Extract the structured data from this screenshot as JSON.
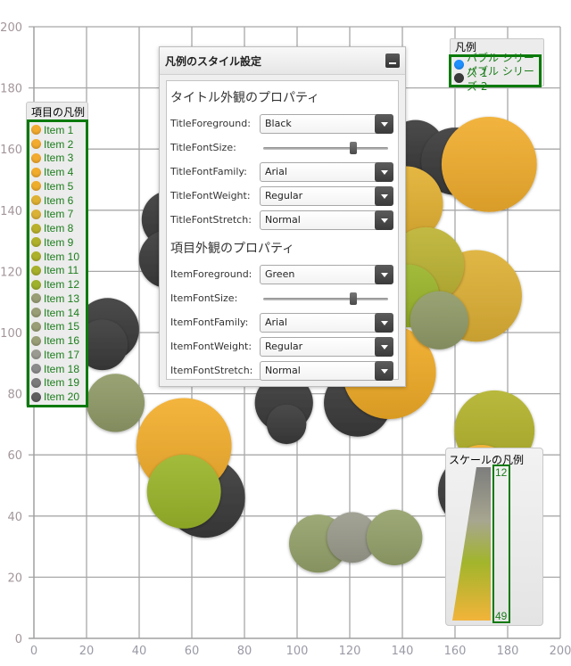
{
  "chart_data": {
    "type": "bubble",
    "title": "",
    "xlabel": "",
    "ylabel": "",
    "xlim": [
      0,
      200
    ],
    "ylim": [
      0,
      200
    ],
    "x_ticks": [
      0,
      20,
      40,
      60,
      80,
      100,
      120,
      140,
      160,
      180,
      200
    ],
    "y_ticks": [
      0,
      20,
      40,
      60,
      80,
      100,
      120,
      140,
      160,
      180,
      200
    ],
    "x_tick_labels": [
      "0",
      "20",
      "40",
      "60",
      "80",
      "100",
      "120",
      "140",
      "160",
      "180",
      "200"
    ],
    "y_tick_labels": [
      "0",
      "20",
      "40",
      "60",
      "80",
      "100",
      "120",
      "140",
      "160",
      "180",
      "200"
    ],
    "grid": true,
    "size_range": [
      12,
      49
    ],
    "series": [
      {
        "name": "バブル シリーズ 2",
        "color": "#3a3a3a",
        "points": [
          {
            "x": 28,
            "y": 101,
            "size": 24
          },
          {
            "x": 26,
            "y": 96,
            "size": 19
          },
          {
            "x": 52,
            "y": 137,
            "size": 22
          },
          {
            "x": 51,
            "y": 124,
            "size": 22
          },
          {
            "x": 65,
            "y": 46,
            "size": 32
          },
          {
            "x": 95,
            "y": 77,
            "size": 22
          },
          {
            "x": 96,
            "y": 70,
            "size": 15
          },
          {
            "x": 123,
            "y": 77,
            "size": 26
          },
          {
            "x": 145,
            "y": 160,
            "size": 22
          },
          {
            "x": 160,
            "y": 156,
            "size": 26
          },
          {
            "x": 168,
            "y": 48,
            "size": 30
          }
        ]
      },
      {
        "name": "バブル シリーズ 1",
        "color": "#1e90ff",
        "points": [
          {
            "x": 57,
            "y": 63,
            "size": 40,
            "color": "#f2ae2c"
          },
          {
            "x": 57,
            "y": 48,
            "size": 29,
            "color": "#9ab52a"
          },
          {
            "x": 31,
            "y": 77,
            "size": 22,
            "color": "#8f9a67"
          },
          {
            "x": 135,
            "y": 87,
            "size": 39,
            "color": "#f0ab27"
          },
          {
            "x": 141,
            "y": 142,
            "size": 30,
            "color": "#e2b032"
          },
          {
            "x": 168,
            "y": 112,
            "size": 38,
            "color": "#ddb035"
          },
          {
            "x": 149,
            "y": 122,
            "size": 30,
            "color": "#bcb333"
          },
          {
            "x": 142,
            "y": 112,
            "size": 24,
            "color": "#9ab52a"
          },
          {
            "x": 154,
            "y": 104,
            "size": 22,
            "color": "#8f9a67"
          },
          {
            "x": 173,
            "y": 155,
            "size": 40,
            "color": "#f0ad2d"
          },
          {
            "x": 175,
            "y": 68,
            "size": 32,
            "color": "#b2b22c"
          },
          {
            "x": 170,
            "y": 53,
            "size": 24,
            "color": "#f0ad2d"
          },
          {
            "x": 108,
            "y": 31,
            "size": 22,
            "color": "#94a16a"
          },
          {
            "x": 121,
            "y": 33,
            "size": 19,
            "color": "#9a9b8c"
          },
          {
            "x": 137,
            "y": 33,
            "size": 21,
            "color": "#94a16a"
          }
        ]
      }
    ]
  },
  "item_legend": {
    "title": "項目の凡例",
    "items": [
      {
        "label": "Item 1",
        "color": "#f2ab2e"
      },
      {
        "label": "Item 2",
        "color": "#f2ab2e"
      },
      {
        "label": "Item 3",
        "color": "#f2ab2e"
      },
      {
        "label": "Item 4",
        "color": "#f1ac2c"
      },
      {
        "label": "Item 5",
        "color": "#eeae2c"
      },
      {
        "label": "Item 6",
        "color": "#dfb132"
      },
      {
        "label": "Item 7",
        "color": "#dab236"
      },
      {
        "label": "Item 8",
        "color": "#b9b12c"
      },
      {
        "label": "Item 9",
        "color": "#b0b12a"
      },
      {
        "label": "Item 10",
        "color": "#acb12b"
      },
      {
        "label": "Item 11",
        "color": "#a7b12a"
      },
      {
        "label": "Item 12",
        "color": "#9db12b"
      },
      {
        "label": "Item 13",
        "color": "#999e76"
      },
      {
        "label": "Item 14",
        "color": "#999e76"
      },
      {
        "label": "Item 15",
        "color": "#999e76"
      },
      {
        "label": "Item 16",
        "color": "#999e76"
      },
      {
        "label": "Item 17",
        "color": "#9a9a90"
      },
      {
        "label": "Item 18",
        "color": "#8b8b8b"
      },
      {
        "label": "Item 19",
        "color": "#7a7a7a"
      },
      {
        "label": "Item 20",
        "color": "#5e5e5e"
      }
    ]
  },
  "series_legend": {
    "title": "凡例",
    "items": [
      {
        "label": "バブル シリーズ 1",
        "color": "#1e90ff"
      },
      {
        "label": "バブル シリーズ 2",
        "color": "#3a3a3a"
      }
    ]
  },
  "scale_legend": {
    "title": "スケールの凡例",
    "min_label": "12",
    "max_label": "49"
  },
  "settings_panel": {
    "title": "凡例のスタイル設定",
    "title_section": "タイトル外観のプロパティ",
    "item_section": "項目外観のプロパティ",
    "title_props": {
      "foreground_label": "TitleForeground:",
      "foreground_value": "Black",
      "fontsize_label": "TitleFontSize:",
      "fontsize_value": 0.72,
      "fontfamily_label": "TitleFontFamily:",
      "fontfamily_value": "Arial",
      "fontweight_label": "TitleFontWeight:",
      "fontweight_value": "Regular",
      "fontstretch_label": "TitleFontStretch:",
      "fontstretch_value": "Normal"
    },
    "item_props": {
      "foreground_label": "ItemForeground:",
      "foreground_value": "Green",
      "fontsize_label": "ItemFontSize:",
      "fontsize_value": 0.72,
      "fontfamily_label": "ItemFontFamily:",
      "fontfamily_value": "Arial",
      "fontweight_label": "ItemFontWeight:",
      "fontweight_value": "Regular",
      "fontstretch_label": "ItemFontStretch:",
      "fontstretch_value": "Normal"
    }
  }
}
